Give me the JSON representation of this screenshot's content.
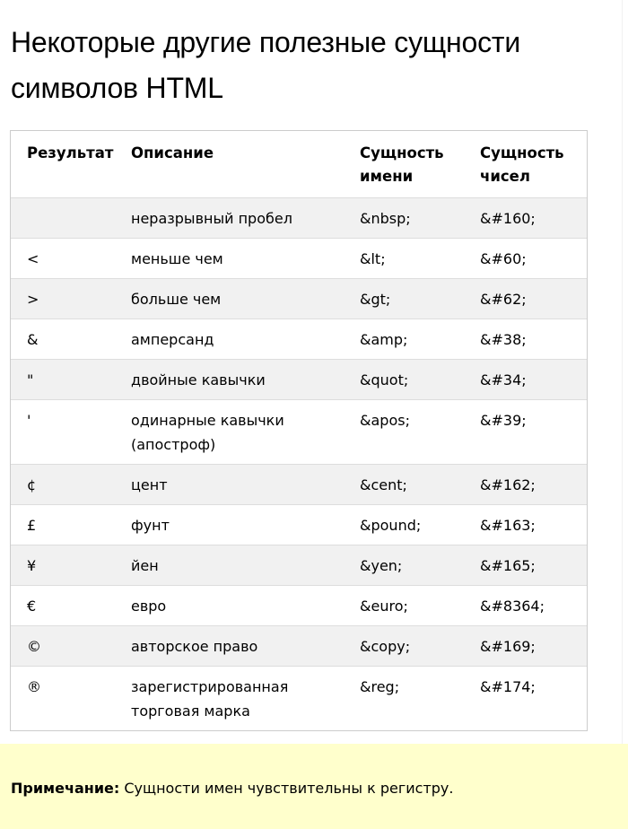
{
  "title": "Некоторые другие полезные сущности символов HTML",
  "table": {
    "headers": {
      "result": "Результат",
      "description": "Описание",
      "entity_name": "Сущность имени",
      "entity_number": "Сущность чисел"
    },
    "rows": [
      {
        "result": " ",
        "description": "неразрывный пробел",
        "name": "&nbsp;",
        "number": "&#160;"
      },
      {
        "result": "<",
        "description": "меньше чем",
        "name": "&lt;",
        "number": "&#60;"
      },
      {
        "result": ">",
        "description": "больше чем",
        "name": "&gt;",
        "number": "&#62;"
      },
      {
        "result": "&",
        "description": "амперсанд",
        "name": "&amp;",
        "number": "&#38;"
      },
      {
        "result": "\"",
        "description": "двойные кавычки",
        "name": "&quot;",
        "number": "&#34;"
      },
      {
        "result": "'",
        "description": "одинарные кавычки (апостроф)",
        "name": "&apos;",
        "number": "&#39;"
      },
      {
        "result": "¢",
        "description": "цент",
        "name": "&cent;",
        "number": "&#162;"
      },
      {
        "result": "£",
        "description": "фунт",
        "name": "&pound;",
        "number": "&#163;"
      },
      {
        "result": "¥",
        "description": "йен",
        "name": "&yen;",
        "number": "&#165;"
      },
      {
        "result": "€",
        "description": "евро",
        "name": "&euro;",
        "number": "&#8364;"
      },
      {
        "result": "©",
        "description": "авторское право",
        "name": "&copy;",
        "number": "&#169;"
      },
      {
        "result": "®",
        "description": "зарегистрированная торговая марка",
        "name": "&reg;",
        "number": "&#174;"
      }
    ]
  },
  "note": {
    "label": "Примечание:",
    "text": "Сущности имен чувствительны к регистру."
  },
  "colors": {
    "stripe": "#f1f1f1",
    "border": "#cccccc",
    "note_background": "#ffffcc"
  }
}
